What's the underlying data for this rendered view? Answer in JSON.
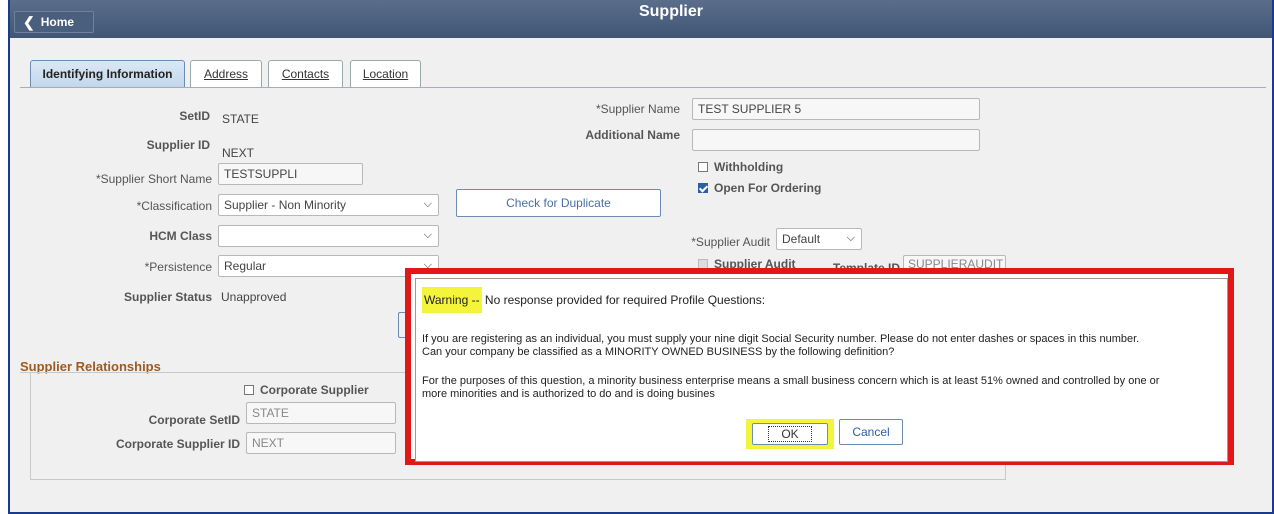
{
  "header": {
    "home_label": "Home",
    "home_icon": "chevron-left-icon",
    "page_title": "Supplier"
  },
  "tabs": [
    {
      "label": "Identifying Information",
      "active": true
    },
    {
      "label": "Address",
      "active": false
    },
    {
      "label": "Contacts",
      "active": false
    },
    {
      "label": "Location",
      "active": false
    }
  ],
  "form": {
    "setid_label": "SetID",
    "setid_value": "STATE",
    "supplier_id_label": "Supplier ID",
    "supplier_id_value": "NEXT",
    "short_name_label": "*Supplier Short Name",
    "short_name_value": "TESTSUPPLI",
    "classification_label": "*Classification",
    "classification_value": "Supplier - Non Minority",
    "check_duplicate_label": "Check for Duplicate",
    "hcm_class_label": "HCM Class",
    "hcm_class_value": "",
    "persistence_label": "*Persistence",
    "persistence_value": "Regular",
    "status_label": "Supplier Status",
    "status_value": "Unapproved",
    "supplier_name_label": "*Supplier Name",
    "supplier_name_value": "TEST SUPPLIER 5",
    "additional_name_label": "Additional Name",
    "additional_name_value": "",
    "withholding_label": "Withholding",
    "withholding_checked": false,
    "open_ordering_label": "Open For Ordering",
    "open_ordering_checked": true,
    "supplier_audit_label": "*Supplier Audit",
    "supplier_audit_value": "Default",
    "supplier_audit_chk_label": "Supplier Audit",
    "template_id_label": "Template ID",
    "template_id_value": "SUPPLIERAUDIT"
  },
  "relationships": {
    "title": "Supplier Relationships",
    "corporate_supplier_label": "Corporate Supplier",
    "corporate_supplier_checked": false,
    "corporate_setid_label": "Corporate SetID",
    "corporate_setid_value": "STATE",
    "corporate_supplier_id_label": "Corporate Supplier ID",
    "corporate_supplier_id_value": "NEXT"
  },
  "dialog": {
    "warning_word": "Warning --",
    "warning_text": " No response provided for required Profile Questions:",
    "message_1": "If you are registering as an individual, you must supply your nine digit Social Security number.  Please do not enter dashes or spaces in this number.",
    "message_2": "Can your company be classified as a MINORITY OWNED BUSINESS by the following definition?",
    "message_3": "For the purposes of this question, a minority business enterprise means a small business concern which is at least 51% owned and controlled by one or",
    "message_4": "more minorities and is authorized to do and is doing busines",
    "ok_label": "OK",
    "cancel_label": "Cancel",
    "highlight_color": "#f4f53a",
    "annotation_border_color": "#e01818"
  }
}
